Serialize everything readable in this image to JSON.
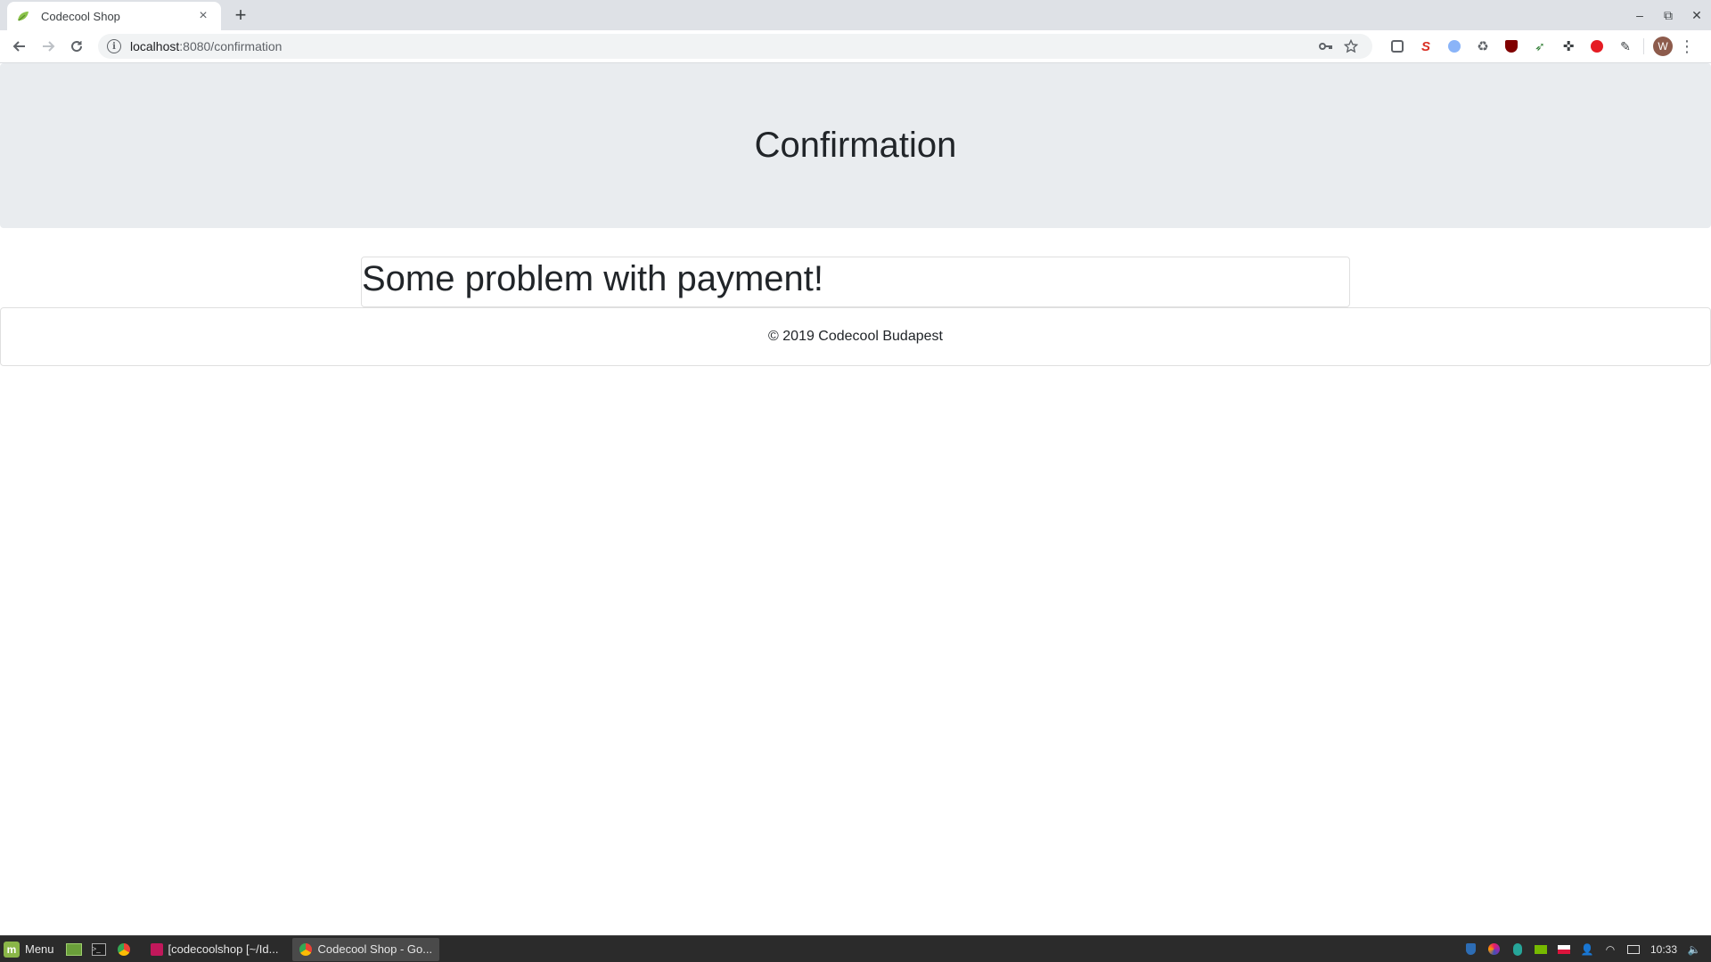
{
  "browser": {
    "tab_title": "Codecool Shop",
    "tab_close": "×",
    "new_tab": "+",
    "url_host": "localhost",
    "url_path": ":8080/confirmation",
    "window_controls": {
      "minimize": "–",
      "restore": "⧉",
      "close": "✕"
    },
    "avatar_letter": "W",
    "extensions": [
      "lastpass-icon",
      "s-extension-icon",
      "circle-extension-icon",
      "recycle-icon",
      "ublock-icon",
      "rocket-icon",
      "crosshair-icon",
      "opera-icon",
      "eyedropper-icon"
    ]
  },
  "page": {
    "title": "Confirmation",
    "message": "Some problem with payment!",
    "footer": "© 2019 Codecool Budapest"
  },
  "taskbar": {
    "menu_label": "Menu",
    "windows": [
      {
        "label": "[codecoolshop [~/Id...",
        "active": false
      },
      {
        "label": "Codecool Shop - Go...",
        "active": true
      }
    ],
    "clock": "10:33"
  },
  "colors": {
    "jumbotron_bg": "#e9ecef",
    "text": "#212529",
    "taskbar_bg": "#2b2b2b"
  }
}
